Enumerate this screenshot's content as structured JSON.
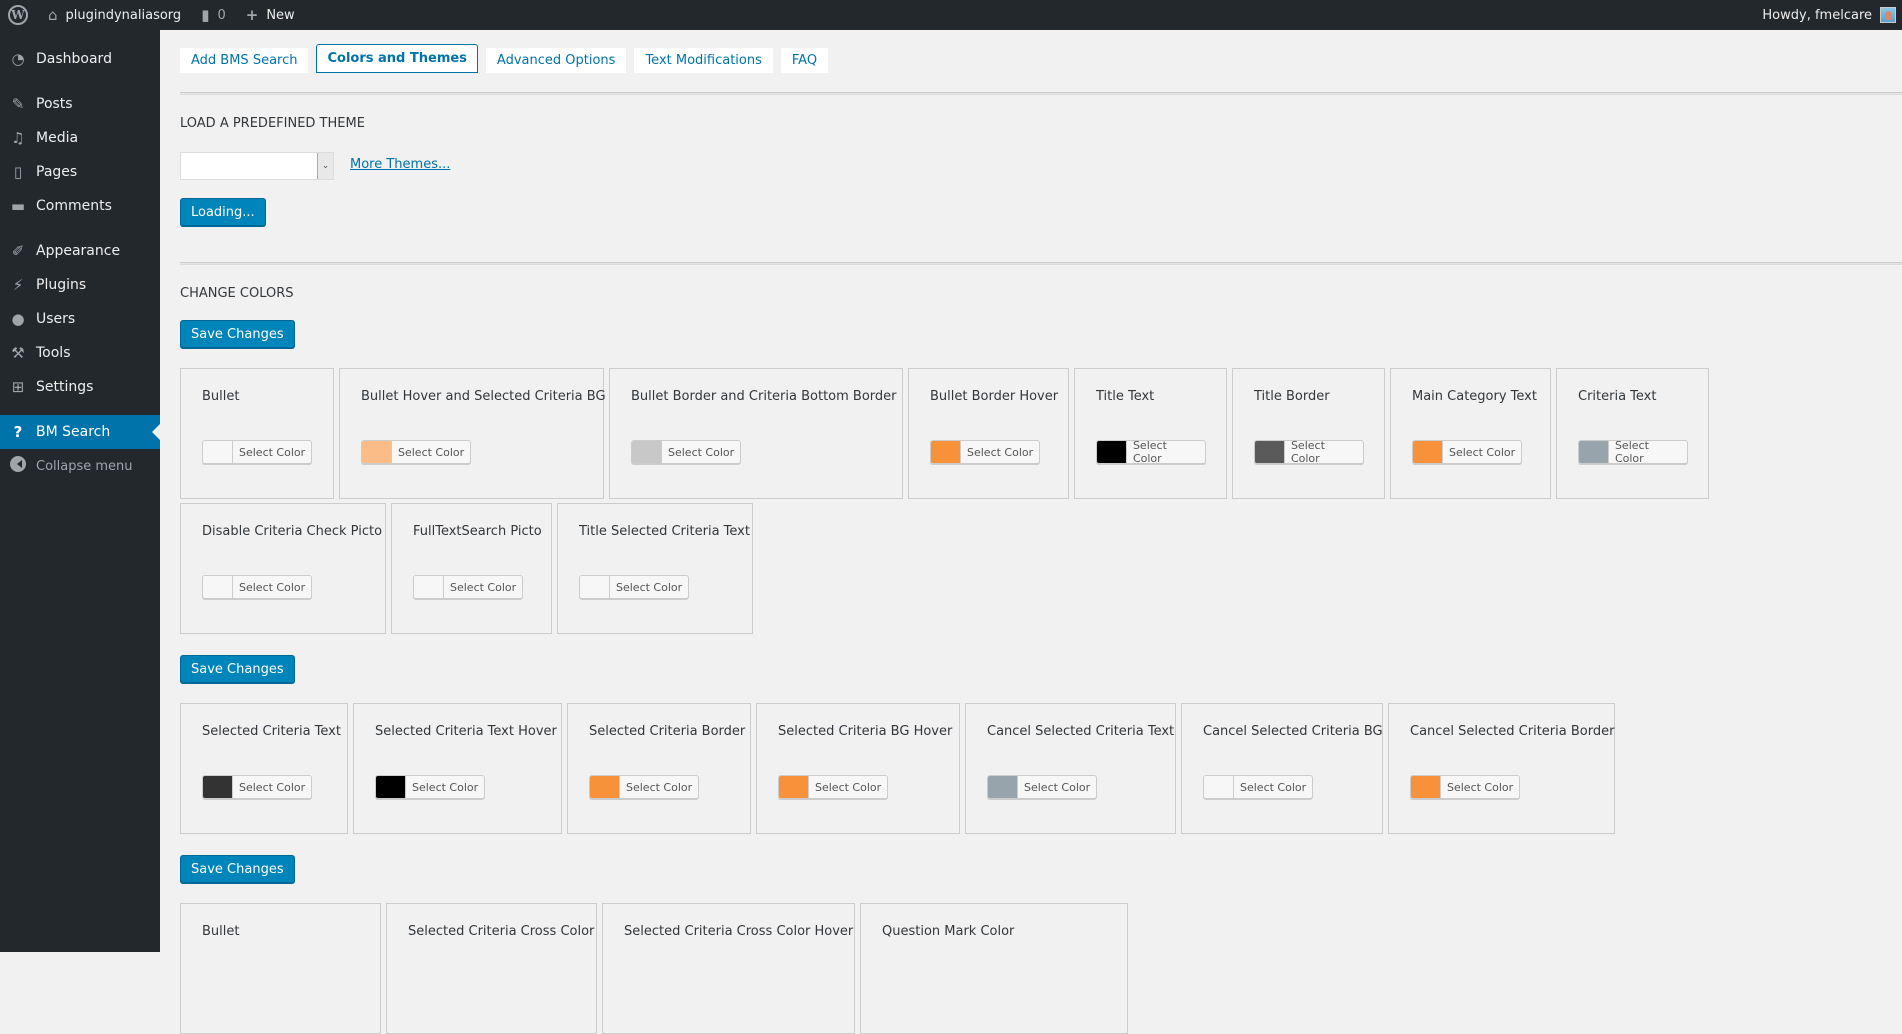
{
  "adminbar": {
    "site_name": "plugindynaliasorg",
    "comments_count": "0",
    "new_label": "New",
    "greeting": "Howdy, fmelcare"
  },
  "sidebar": {
    "items": [
      {
        "label": "Dashboard",
        "icon": "dashboard-icon"
      },
      {
        "label": "Posts",
        "icon": "pin-icon"
      },
      {
        "label": "Media",
        "icon": "media-icon"
      },
      {
        "label": "Pages",
        "icon": "pages-icon"
      },
      {
        "label": "Comments",
        "icon": "comment-icon"
      },
      {
        "label": "Appearance",
        "icon": "paintbrush-icon"
      },
      {
        "label": "Plugins",
        "icon": "plugin-icon"
      },
      {
        "label": "Users",
        "icon": "user-icon"
      },
      {
        "label": "Tools",
        "icon": "wrench-icon"
      },
      {
        "label": "Settings",
        "icon": "settings-icon"
      },
      {
        "label": "BM Search",
        "icon": "question-icon"
      },
      {
        "label": "Collapse menu",
        "icon": "collapse-icon"
      }
    ]
  },
  "tabs": [
    {
      "label": "Add BMS Search"
    },
    {
      "label": "Colors and Themes",
      "active": true
    },
    {
      "label": "Advanced Options"
    },
    {
      "label": "Text Modifications"
    },
    {
      "label": "FAQ"
    }
  ],
  "theme_section": {
    "title": "Load a predefined theme",
    "select_value": "",
    "more_themes_label": "More Themes...",
    "loading_label": "Loading..."
  },
  "colors_section": {
    "title": "Change Colors",
    "save_label": "Save Changes",
    "select_color_label": "Select Color",
    "group1_row1": [
      {
        "label": "Bullet",
        "color": "#f7f7f7"
      },
      {
        "label": "Bullet Hover and Selected Criteria BG",
        "color": "#fbbc87"
      },
      {
        "label": "Bullet Border and Criteria Bottom Border",
        "color": "#c8c8c8"
      },
      {
        "label": "Bullet Border Hover",
        "color": "#f7923a"
      },
      {
        "label": "Title Text",
        "color": "#000000"
      },
      {
        "label": "Title Border",
        "color": "#5a5a5a"
      },
      {
        "label": "Main Category Text",
        "color": "#f7923a"
      },
      {
        "label": "Criteria Text",
        "color": "#98a4ab"
      }
    ],
    "group1_row2": [
      {
        "label": "Disable Criteria Check Picto",
        "color": "#f7f7f7"
      },
      {
        "label": "FullTextSearch Picto",
        "color": "#f7f7f7"
      },
      {
        "label": "Title Selected Criteria Text",
        "color": "#f7f7f7"
      }
    ],
    "group2": [
      {
        "label": "Selected Criteria Text",
        "color": "#333333"
      },
      {
        "label": "Selected Criteria Text Hover",
        "color": "#000000"
      },
      {
        "label": "Selected Criteria Border",
        "color": "#f7923a"
      },
      {
        "label": "Selected Criteria BG Hover",
        "color": "#f7923a"
      },
      {
        "label": "Cancel Selected Criteria Text",
        "color": "#98a4ab"
      },
      {
        "label": "Cancel Selected Criteria BG",
        "color": "#f7f7f7"
      },
      {
        "label": "Cancel Selected Criteria Border",
        "color": "#f7923a"
      }
    ],
    "group3": [
      {
        "label": "Bullet"
      },
      {
        "label": "Selected Criteria Cross Color"
      },
      {
        "label": "Selected Criteria Cross Color Hover"
      },
      {
        "label": "Question Mark Color"
      }
    ]
  }
}
